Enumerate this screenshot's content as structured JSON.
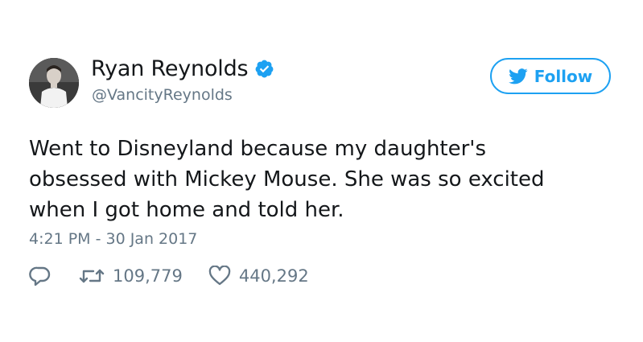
{
  "author": {
    "display_name": "Ryan Reynolds",
    "handle": "@VancityReynolds",
    "verified": true
  },
  "follow_button": {
    "label": "Follow",
    "icon": "twitter-bird-icon"
  },
  "tweet": {
    "text": "Went to Disneyland because my daughter's\nobsessed with Mickey Mouse. She was so excited\nwhen I got home and told her.",
    "timestamp": "4:21 PM - 30 Jan 2017"
  },
  "actions": {
    "reply_icon": "reply-icon",
    "retweet_icon": "retweet-icon",
    "retweet_count": "109,779",
    "like_icon": "heart-icon",
    "like_count": "440,292"
  },
  "colors": {
    "accent": "#1da1f2",
    "text": "#14171a",
    "secondary_text": "#657786"
  }
}
